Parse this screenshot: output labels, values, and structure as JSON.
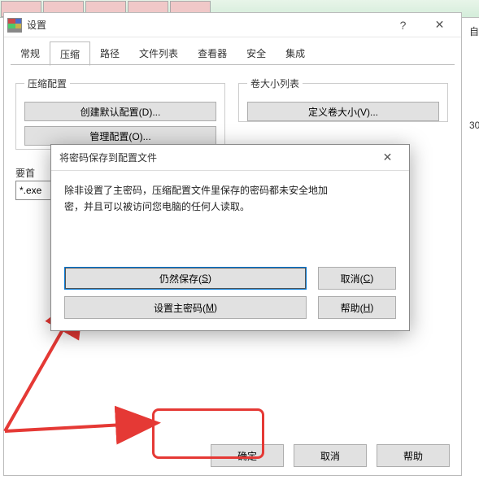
{
  "bg": {
    "right1": "自",
    "right2": "30"
  },
  "settings": {
    "title": "设置",
    "tabs": [
      "常规",
      "压缩",
      "路径",
      "文件列表",
      "查看器",
      "安全",
      "集成"
    ],
    "active_tab": 1,
    "group_compress_legend": "压缩配置",
    "btn_create_default": "创建默认配置(D)...",
    "btn_manage": "管理配置(O)...",
    "group_volume_legend": "卷大小列表",
    "btn_define_volume": "定义卷大小(V)...",
    "label_prefix": "要首",
    "ext_value": "*.exe",
    "ok": "确定",
    "cancel": "取消",
    "help": "帮助"
  },
  "dialog": {
    "title": "将密码保存到配置文件",
    "message_l1": "除非设置了主密码，压缩配置文件里保存的密码都未安全地加",
    "message_l2": "密，并且可以被访问您电脑的任何人读取。",
    "still_save": "仍然保存(",
    "still_save_hot": "S",
    "still_save_end": ")",
    "set_master": "设置主密码(",
    "set_master_hot": "M",
    "set_master_end": ")",
    "cancel": "取消(",
    "cancel_hot": "C",
    "cancel_end": ")",
    "help": "帮助(",
    "help_hot": "H",
    "help_end": ")"
  }
}
